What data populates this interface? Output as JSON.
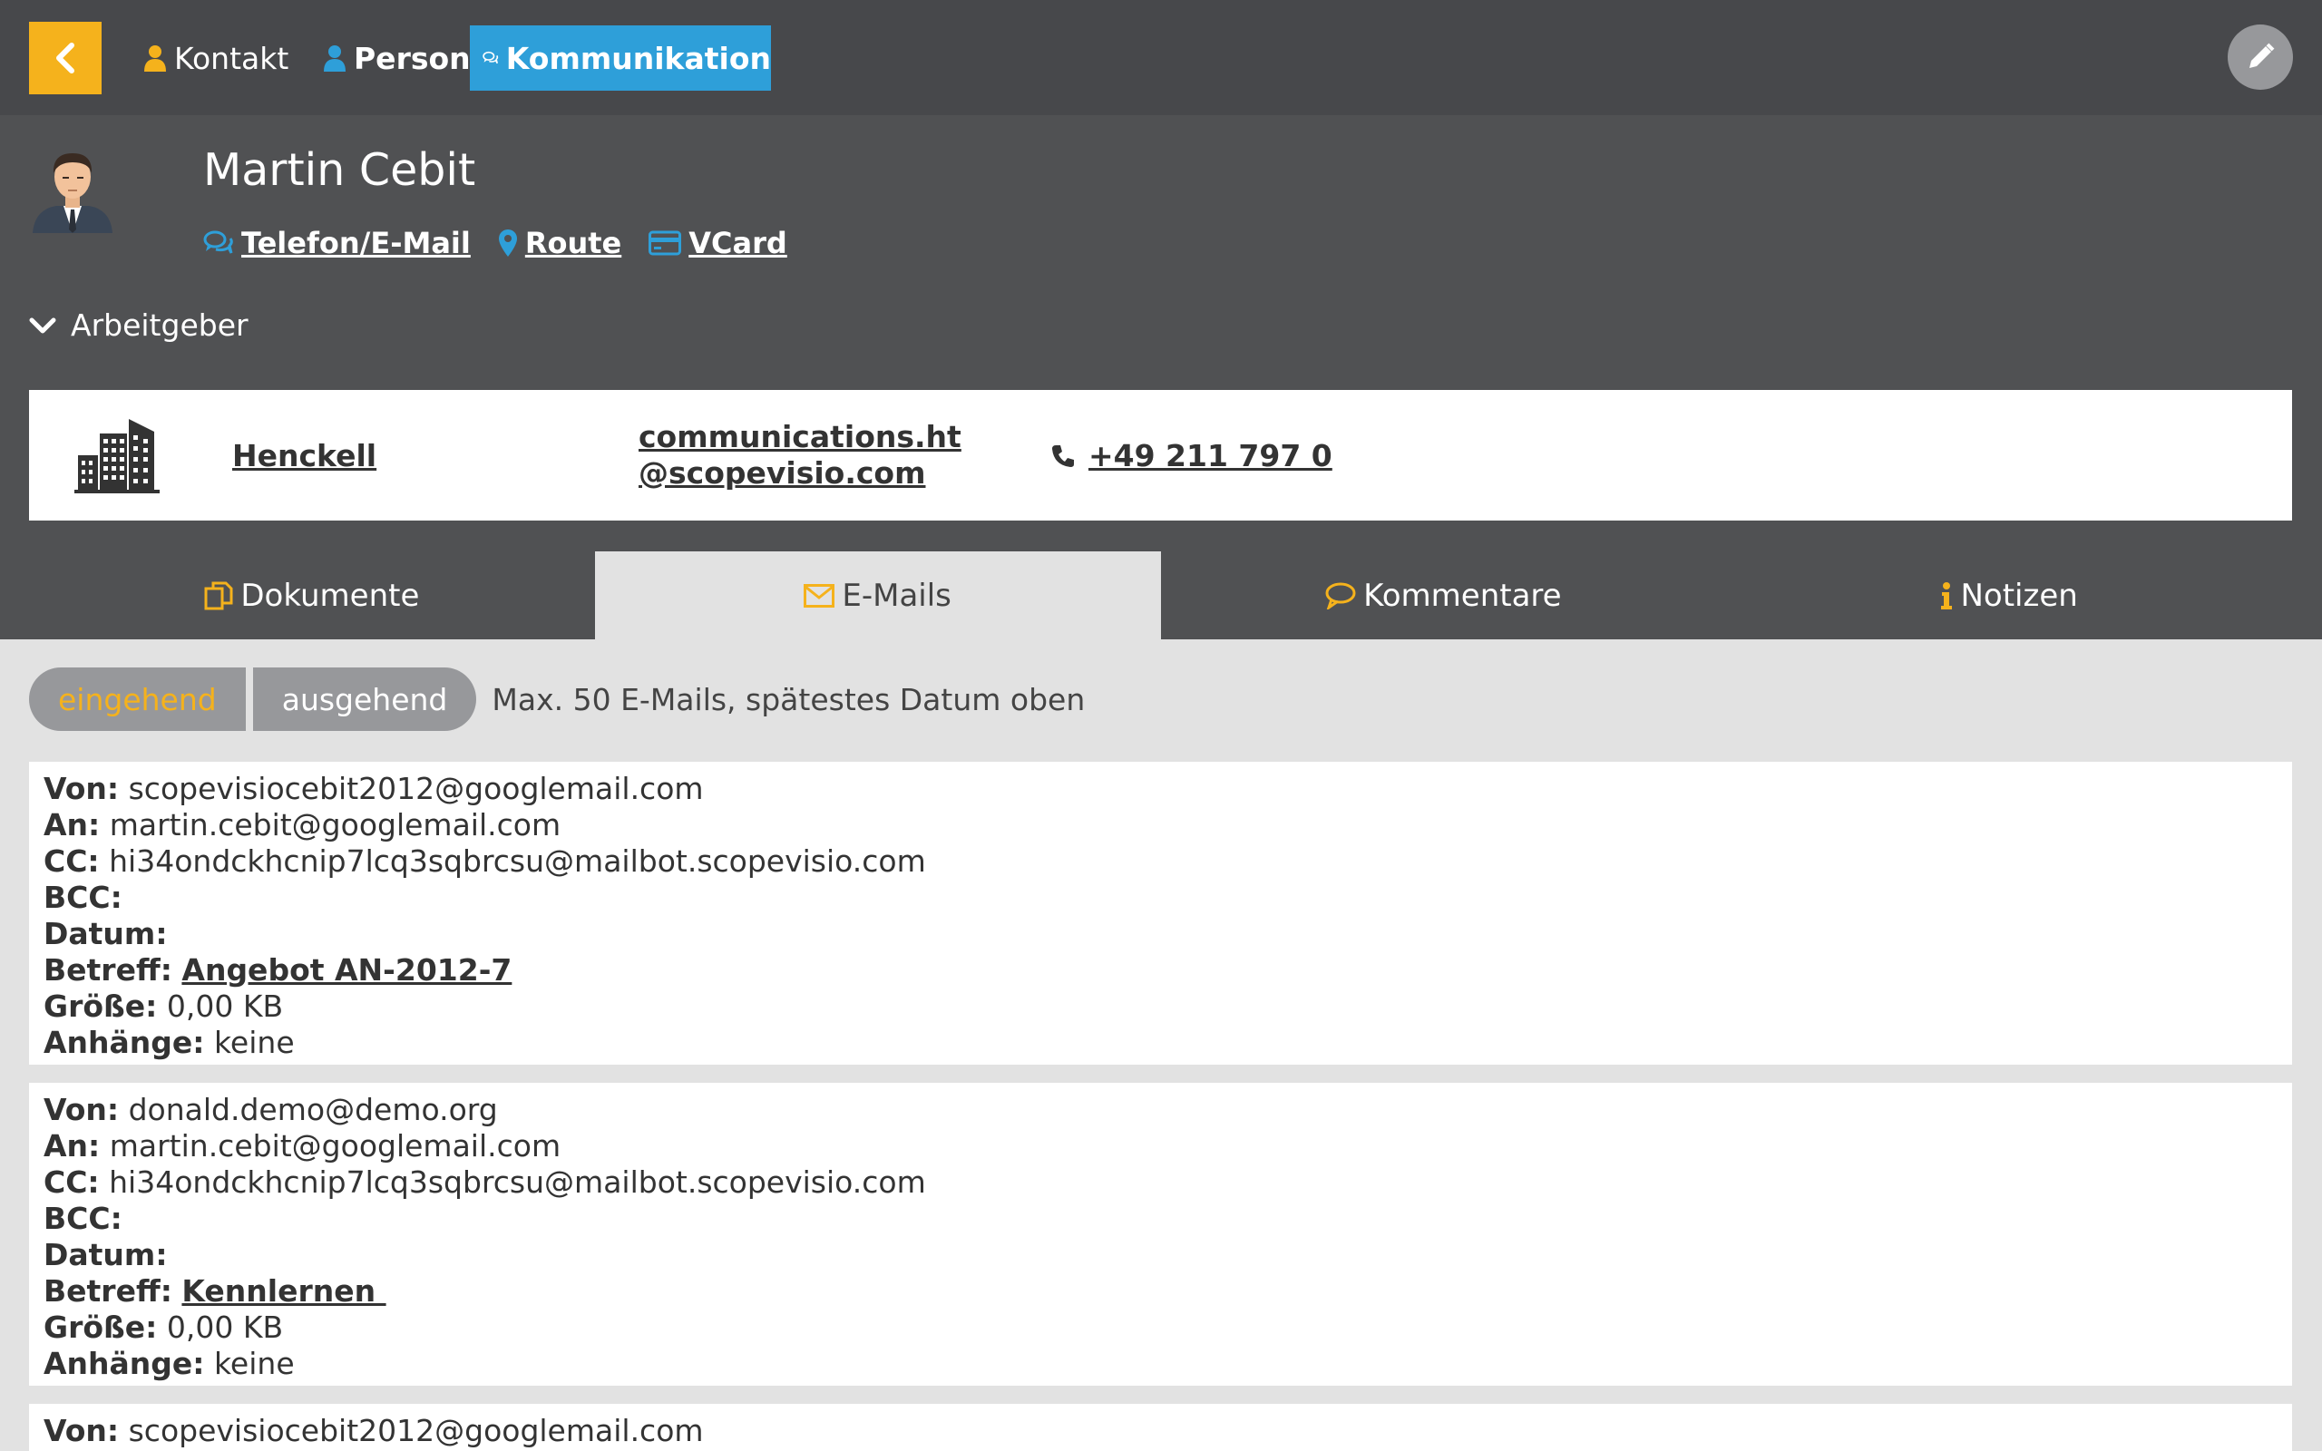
{
  "nav": {
    "back_icon": "chevron-left-icon",
    "kontakt_label": "Kontakt",
    "person_label": "Person",
    "kommunikation_label": "Kommunikation",
    "edit_icon": "pencil-icon"
  },
  "person": {
    "name": "Martin Cebit",
    "links": {
      "phone_email": "Telefon/E-Mail",
      "route": "Route",
      "vcard": "VCard"
    }
  },
  "employer": {
    "toggle_label": "Arbeitgeber",
    "name": "Henckell",
    "email_line1": "communications.ht",
    "email_line2": "@scopevisio.com",
    "phone": "+49 211 797 0"
  },
  "tabs": [
    {
      "label": "Dokumente",
      "icon": "documents-icon"
    },
    {
      "label": "E-Mails",
      "icon": "envelope-icon"
    },
    {
      "label": "Kommentare",
      "icon": "comment-icon"
    },
    {
      "label": "Notizen",
      "icon": "info-icon"
    }
  ],
  "filter": {
    "incoming": "eingehend",
    "outgoing": "ausgehend",
    "note": "Max. 50 E-Mails, spätestes Datum oben"
  },
  "labels": {
    "from": "Von:",
    "to": "An:",
    "cc": "CC:",
    "bcc": "BCC:",
    "date": "Datum:",
    "subject": "Betreff:",
    "size": "Größe:",
    "attachments": "Anhänge:"
  },
  "emails": [
    {
      "from": "scopevisiocebit2012@googlemail.com",
      "to": "martin.cebit@googlemail.com",
      "cc": "hi34ondckhcnip7lcq3sqbrcsu@mailbot.scopevisio.com",
      "bcc": "",
      "date": "",
      "subject": "Angebot AN-2012-7",
      "size": "0,00 KB",
      "attachments": "keine"
    },
    {
      "from": "donald.demo@demo.org",
      "to": "martin.cebit@googlemail.com",
      "cc": "hi34ondckhcnip7lcq3sqbrcsu@mailbot.scopevisio.com",
      "bcc": "",
      "date": "",
      "subject": "Kennlernen ",
      "size": "0,00 KB",
      "attachments": "keine"
    },
    {
      "from": "scopevisiocebit2012@googlemail.com"
    }
  ],
  "colors": {
    "accent_yellow": "#f5b21c",
    "accent_blue": "#2e9fd9",
    "topbar": "#47484b",
    "header": "#505153"
  }
}
